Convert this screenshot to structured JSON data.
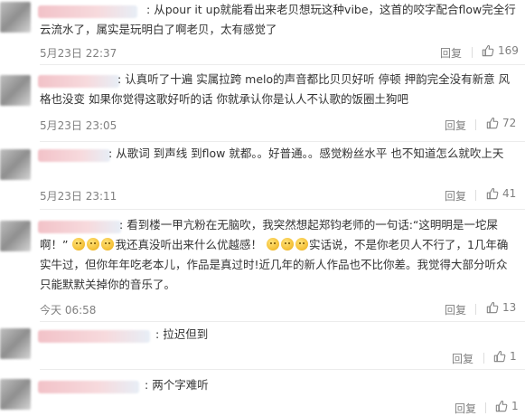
{
  "comments": [
    {
      "text": "从pour it up就能看出来老贝想玩这种vibe，这首的咬字配合flow完全行云流水了，属实是玩明白了啊老贝，太有感觉了",
      "time": "5月23日 22:37",
      "reply": "回复",
      "likes": "169"
    },
    {
      "text": "认真听了十遍 实属拉跨 melo的声音都比贝贝好听 停顿 押韵完全没有新意 风格也没变 如果你觉得这歌好听的话 你就承认你是认人不认歌的饭圈土狗吧",
      "time": "5月23日 23:05",
      "reply": "回复",
      "likes": "72"
    },
    {
      "text": "从歌词 到声线 到flow 就都。。好普通。。感觉粉丝水平 也不知道怎么就吹上天",
      "time": "5月23日 23:11",
      "reply": "回复",
      "likes": "41"
    },
    {
      "text_a": "看到楼一甲亢粉在无脑吹，我突然想起郑钧老师的一句话:“这明明是一坨屎啊！”",
      "text_b": "我还真没听出来什么优越感！",
      "text_c": "实话说，不是你老贝人不行了，1几年确实牛过，但你年年吃老本儿，作品是真过时!近几年的新人作品也不比你差。我觉得大部分听众只能默默关掉你的音乐了。",
      "time": "今天 06:58",
      "reply": "回复",
      "likes": "13"
    },
    {
      "text": "拉迟但到",
      "time": "",
      "reply": "回复",
      "likes": "1"
    },
    {
      "text": "两个字难听",
      "time": "",
      "reply": "回复",
      "likes": "1"
    }
  ],
  "icons": {
    "like": "thumbs-up-icon"
  },
  "colors": {
    "text": "#333333",
    "meta": "#808080",
    "divider": "#ececec"
  }
}
